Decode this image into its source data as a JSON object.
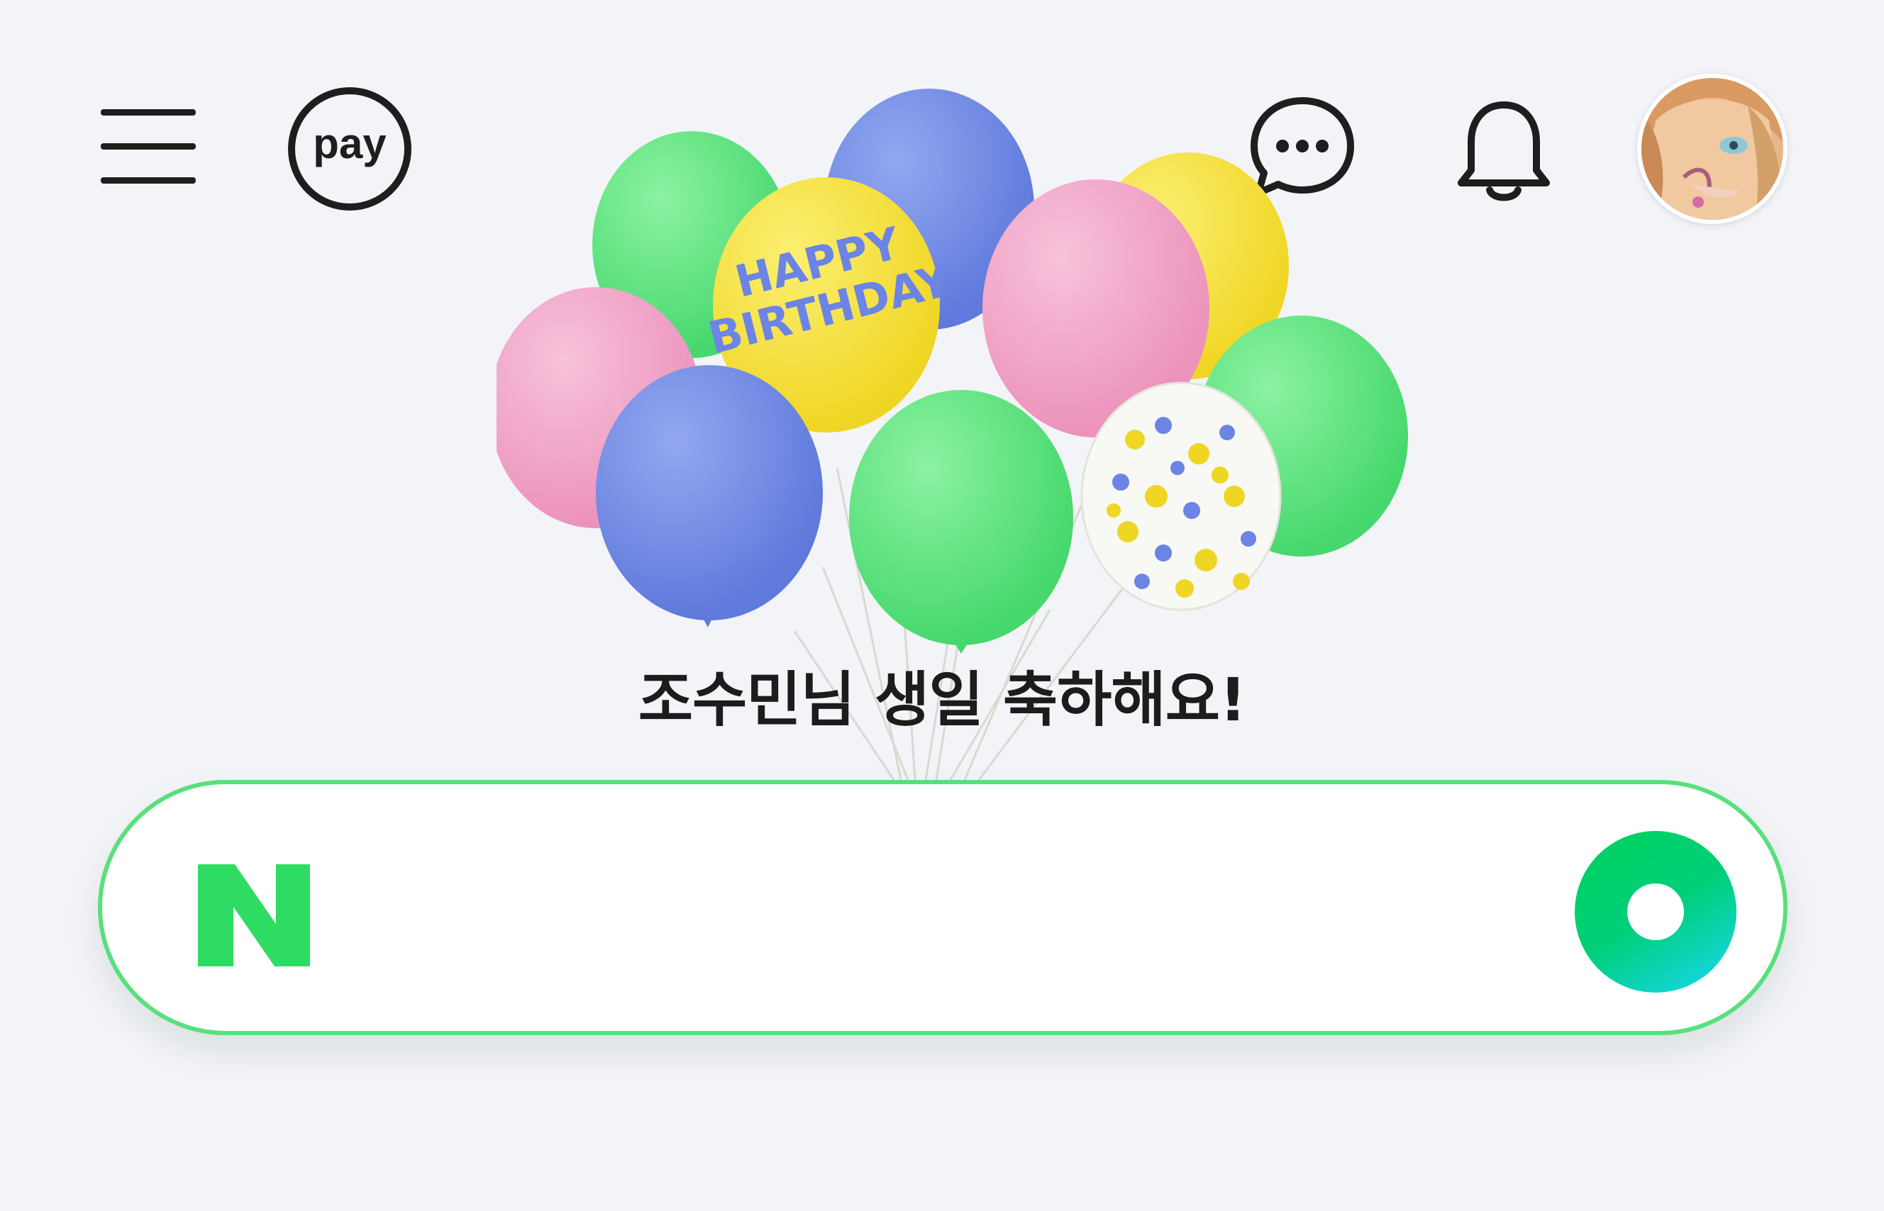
{
  "header": {
    "menu_icon": "hamburger-menu-icon",
    "pay_label": "pay",
    "talk_icon": "chat-bubble-icon",
    "notification_icon": "bell-icon",
    "profile_icon": "avatar"
  },
  "hero": {
    "decoration": "birthday-balloons",
    "balloon_text_line1": "HAPPY",
    "balloon_text_line2": "BIRTHDAY",
    "message": "조수민님 생일 축하해요!"
  },
  "search": {
    "logo_text": "N",
    "value": "",
    "placeholder": "",
    "search_icon": "search-ring-icon"
  },
  "colors": {
    "background": "#f3f4f8",
    "brand_green": "#03c75a",
    "search_border": "#58e07c",
    "balloon_green": "#5fe07e",
    "balloon_blue": "#7089e0",
    "balloon_pink": "#f1a5c8",
    "balloon_yellow": "#f6e23a"
  }
}
